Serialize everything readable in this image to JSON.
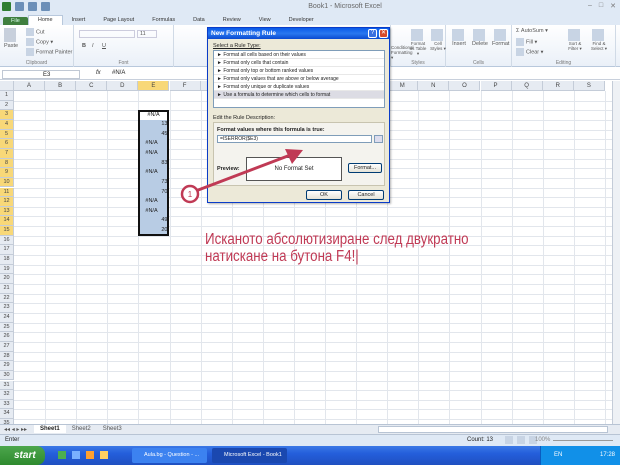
{
  "window": {
    "title": "Book1 - Microsoft Excel"
  },
  "tabs": [
    "File",
    "Home",
    "Insert",
    "Page Layout",
    "Formulas",
    "Data",
    "Review",
    "View",
    "Developer"
  ],
  "ribbon": {
    "clipboard": {
      "paste": "Paste",
      "cut": "Cut",
      "copy": "Copy ▾",
      "format_painter": "Format Painter",
      "label": "Clipboard"
    },
    "font": {
      "label": "Font",
      "size": "11",
      "bold": "B",
      "italic": "I",
      "underline": "U"
    },
    "styles": {
      "conditional": "Conditional Formatting ▾",
      "format_table": "Format as Table ▾",
      "cell_styles": "Cell Styles ▾",
      "label": "Styles"
    },
    "cells": {
      "insert": "Insert",
      "delete": "Delete",
      "format": "Format",
      "label": "Cells"
    },
    "editing": {
      "autosum": "Σ AutoSum ▾",
      "fill": "Fill ▾",
      "clear": "Clear ▾",
      "sort": "Sort & Filter ▾",
      "find": "Find & Select ▾",
      "label": "Editing"
    }
  },
  "formula_bar": {
    "name_box": "E3",
    "fx": "fx",
    "value": "#N/A"
  },
  "sheet": {
    "columns": [
      "A",
      "B",
      "C",
      "D",
      "E",
      "F",
      "G",
      "H",
      "I",
      "J",
      "K",
      "L",
      "M",
      "N",
      "O",
      "P",
      "Q",
      "R",
      "S"
    ],
    "selected_column": "E",
    "row_count": 35,
    "selected_rows": [
      3,
      15
    ],
    "cells": [
      {
        "row": 3,
        "v": "#N/A",
        "err": true
      },
      {
        "row": 4,
        "v": "13"
      },
      {
        "row": 5,
        "v": "45"
      },
      {
        "row": 6,
        "v": "#N/A",
        "err": true
      },
      {
        "row": 7,
        "v": "#N/A",
        "err": true
      },
      {
        "row": 8,
        "v": "83"
      },
      {
        "row": 9,
        "v": "#N/A",
        "err": true
      },
      {
        "row": 10,
        "v": "73"
      },
      {
        "row": 11,
        "v": "70"
      },
      {
        "row": 12,
        "v": "#N/A",
        "err": true
      },
      {
        "row": 13,
        "v": "#N/A",
        "err": true
      },
      {
        "row": 14,
        "v": "49"
      },
      {
        "row": 15,
        "v": "20"
      }
    ]
  },
  "dialog": {
    "title": "New Formatting Rule",
    "help": "?",
    "close": "✕",
    "select_label": "Select a Rule Type:",
    "rules": [
      "► Format all cells based on their values",
      "► Format only cells that contain",
      "► Format only top or bottom ranked values",
      "► Format only values that are above or below average",
      "► Format only unique or duplicate values",
      "► Use a formula to determine which cells to format"
    ],
    "selected_rule": 5,
    "edit_label": "Edit the Rule Description:",
    "formula_label": "Format values where this formula is true:",
    "formula": "=ISERROR($E3)",
    "preview_label": "Preview:",
    "preview_text": "No Format Set",
    "format_btn": "Format...",
    "ok": "OK",
    "cancel": "Cancel"
  },
  "annotation": {
    "marker": "1",
    "line1": "Исканото абсолютизиране след двукратно",
    "line2": "натискане на бутона F4!|",
    "color": "#c03a55"
  },
  "sheet_tabs": [
    "Sheet1",
    "Sheet2",
    "Sheet3"
  ],
  "status": {
    "mode": "Enter",
    "count": "Count: 13",
    "zoom": "100%"
  },
  "taskbar": {
    "start": "start",
    "tasks": [
      "Aula.bg - Question - ...",
      "Microsoft Excel - Book1"
    ],
    "lang": "EN",
    "time": "17:28"
  }
}
